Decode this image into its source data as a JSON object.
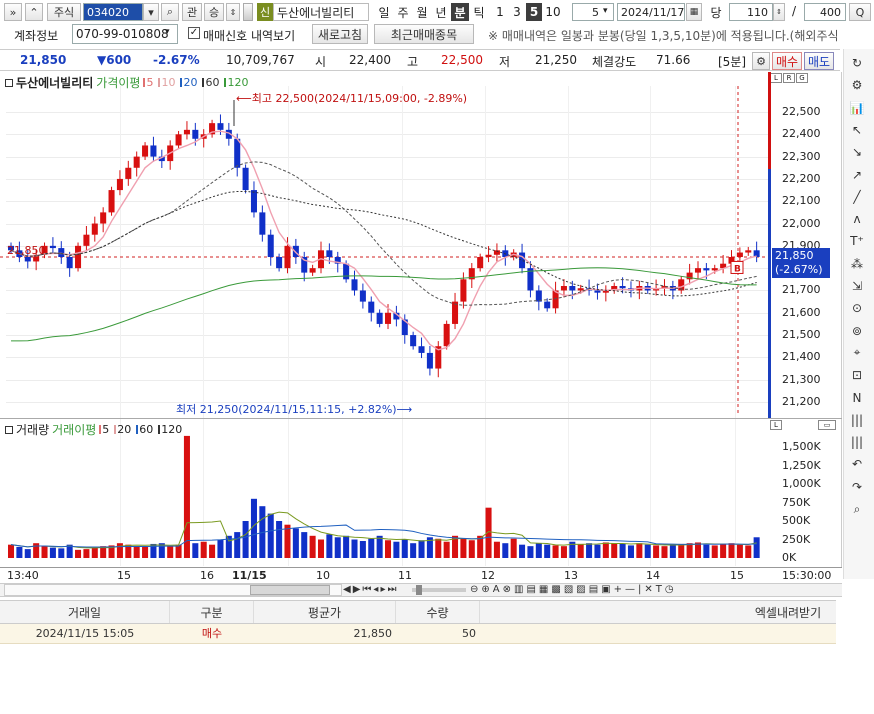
{
  "toolbar": {
    "menu_glyph": "»",
    "up_glyph": "⌃",
    "market": "주식",
    "code": "034020",
    "search_glyph": "⌕",
    "btn_gwan": "관",
    "btn_seung": "승",
    "new_badge": "신",
    "stock_name": "두산에너빌리티",
    "periods": [
      "일",
      "주",
      "월",
      "년",
      "분",
      "틱"
    ],
    "period_selected": "분",
    "minutes": [
      "1",
      "3",
      "5",
      "10"
    ],
    "minute_selected": "5",
    "count": "5",
    "date": "2024/11/17",
    "today": "당",
    "bars_shown": "110",
    "slash": "/",
    "bars_total": "400",
    "zoom_glyph": "Q"
  },
  "account": {
    "label": "계좌정보",
    "number": "070-99-010808",
    "trade_signal_label": "매매신호 내역보기",
    "refresh": "새로고침",
    "recent_trades": "최근매매종목",
    "notice": "※ 매매내역은 일봉과 분봉(당일 1,3,5,10분)에 적용됩니다.(해외주식"
  },
  "quote": {
    "price": "21,850",
    "change": "▼600",
    "change_pct": "-2.67%",
    "volume": "10,709,767",
    "open_label": "시",
    "open": "22,400",
    "high_label": "고",
    "high": "22,500",
    "low_label": "저",
    "low": "21,250",
    "strength_label": "체결강도",
    "strength": "71.66",
    "interval": "[5분]",
    "buy": "매수",
    "sell": "매도"
  },
  "legend": {
    "name": "두산에너빌리티",
    "ma_label": "가격이평",
    "ma_periods": [
      "5",
      "10",
      "20",
      "60",
      "120"
    ],
    "ma_colors": [
      "#e07070",
      "#e0a0a0",
      "#2060c0",
      "#333333",
      "#3a9a3a"
    ]
  },
  "annotations": {
    "high_note": "⟵최고 22,500(2024/11/15,09:00, -2.89%)",
    "low_note": "최저 21,250(2024/11/15,11:15, +2.82%)⟶",
    "left_price": "21,850",
    "current_price": "21,850",
    "current_pct": "(-2.67%)"
  },
  "volume_legend": {
    "label": "거래량",
    "ma_label": "거래이평",
    "periods": [
      "5",
      "20",
      "60",
      "120"
    ]
  },
  "chart_data": {
    "type": "candlestick",
    "price_axis": [
      "22,500",
      "22,400",
      "22,300",
      "22,200",
      "22,100",
      "22,000",
      "21,900",
      "21,800",
      "21,700",
      "21,600",
      "21,500",
      "21,400",
      "21,300",
      "21,200"
    ],
    "volume_axis": [
      "1,500K",
      "1,250K",
      "1,000K",
      "750K",
      "500K",
      "250K",
      "0K"
    ],
    "x_labels": [
      "13:40",
      "15",
      "16",
      "11/15",
      "10",
      "11",
      "12",
      "13",
      "14",
      "15",
      "15:30:00"
    ],
    "high": 22500,
    "low": 21250,
    "last": 21850,
    "closes": [
      21880,
      21850,
      21830,
      21860,
      21900,
      21890,
      21850,
      21800,
      21900,
      21950,
      22000,
      22050,
      22150,
      22200,
      22250,
      22300,
      22350,
      22300,
      22280,
      22350,
      22400,
      22420,
      22380,
      22400,
      22450,
      22420,
      22380,
      22250,
      22150,
      22050,
      21950,
      21850,
      21800,
      21900,
      21850,
      21780,
      21800,
      21880,
      21850,
      21820,
      21750,
      21700,
      21650,
      21600,
      21550,
      21600,
      21570,
      21500,
      21450,
      21420,
      21350,
      21450,
      21550,
      21650,
      21750,
      21800,
      21850,
      21860,
      21880,
      21850,
      21870,
      21800,
      21700,
      21650,
      21620,
      21700,
      21720,
      21700,
      21710,
      21700,
      21690,
      21700,
      21720,
      21710,
      21700,
      21720,
      21700,
      21710,
      21720,
      21700,
      21750,
      21780,
      21800,
      21790,
      21800,
      21820,
      21850,
      21870,
      21880,
      21850
    ],
    "volumes": [
      180,
      150,
      120,
      200,
      160,
      140,
      130,
      180,
      110,
      120,
      140,
      160,
      170,
      200,
      180,
      160,
      150,
      190,
      200,
      160,
      180,
      1650,
      200,
      220,
      180,
      250,
      300,
      350,
      500,
      800,
      700,
      600,
      500,
      450,
      400,
      350,
      300,
      250,
      320,
      280,
      300,
      250,
      230,
      260,
      300,
      240,
      220,
      250,
      200,
      240,
      280,
      260,
      220,
      300,
      260,
      240,
      300,
      680,
      220,
      200,
      260,
      180,
      160,
      200,
      180,
      170,
      160,
      220,
      190,
      200,
      180,
      210,
      200,
      190,
      170,
      200,
      180,
      170,
      160,
      180,
      190,
      200,
      210,
      180,
      170,
      190,
      200,
      180,
      170,
      280
    ]
  },
  "nav": {
    "controls": [
      "◀",
      "▶",
      "⏮",
      "◂",
      "▸",
      "⏭",
      "⊖",
      "⊕",
      "A",
      "⊗"
    ]
  },
  "table": {
    "headers": [
      "거래일",
      "구분",
      "평균가",
      "수량",
      "엑셀내려받기"
    ],
    "rows": [
      {
        "date": "2024/11/15 15:05",
        "type": "매수",
        "avg": "21,850",
        "qty": "50"
      }
    ]
  }
}
